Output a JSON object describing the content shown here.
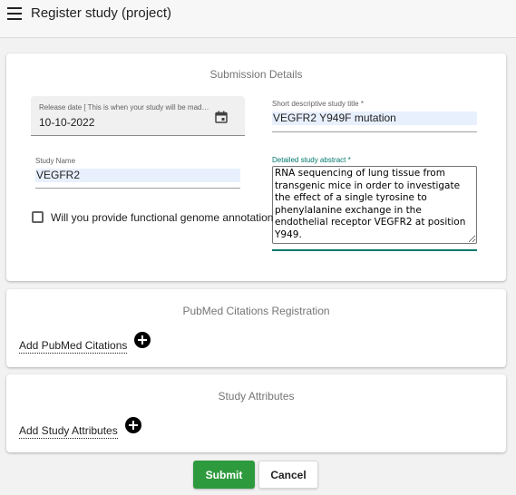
{
  "header": {
    "title": "Register study (project)"
  },
  "submission": {
    "heading": "Submission Details",
    "release_date_label": "Release date [ This is when your study will be made public ]",
    "release_date_value": "10-10-2022",
    "short_title_label": "Short descriptive study title *",
    "short_title_value": "VEGFR2 Y949F mutation",
    "study_name_label": "Study Name",
    "study_name_value": "VEGFR2",
    "abstract_label": "Detailed study abstract *",
    "abstract_value": "RNA sequencing of lung tissue from transgenic mice in order to investigate the effect of a single tyrosine to phenylalanine exchange in the endothelial receptor VEGFR2 at position Y949.",
    "checkbox_label": "Will you provide functional genome annotation?"
  },
  "pubmed": {
    "heading": "PubMed Citations Registration",
    "add_label": "Add PubMed Citations"
  },
  "attributes": {
    "heading": "Study Attributes",
    "add_label": "Add Study Attributes"
  },
  "actions": {
    "submit_label": "Submit",
    "cancel_label": "Cancel"
  },
  "colors": {
    "submit": "#2e9a3e",
    "accent": "#00796b",
    "autofill": "#e8f0fe"
  },
  "icons": {
    "menu": "menu-icon",
    "calendar": "calendar-icon",
    "add": "plus-circle-icon"
  }
}
